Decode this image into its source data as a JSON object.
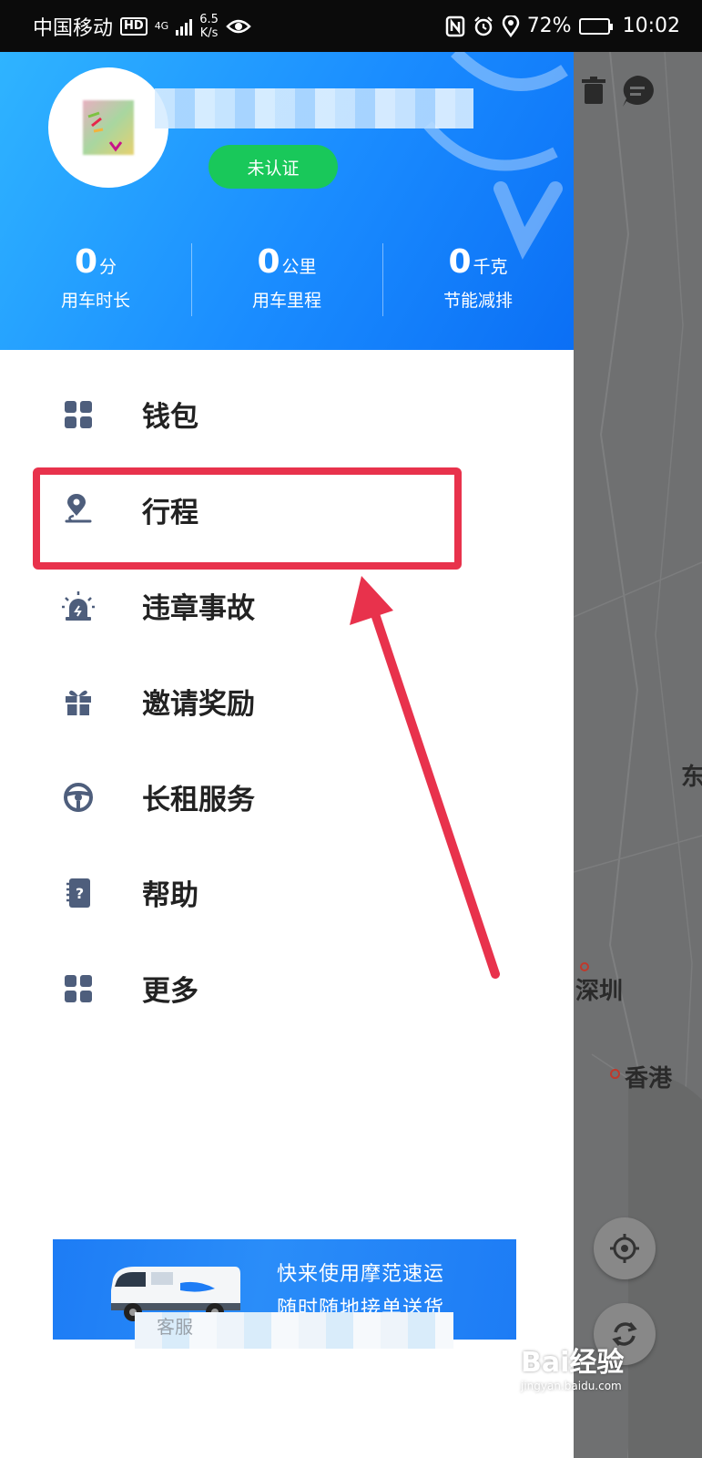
{
  "status_bar": {
    "carrier": "中国移动",
    "hd": "HD",
    "network": "4G",
    "speed_value": "6.5",
    "speed_unit": "K/s",
    "battery": "72%",
    "battery_level": 0.72,
    "time": "10:02"
  },
  "profile": {
    "cert_label": "未认证"
  },
  "stats": [
    {
      "value": "0",
      "unit": "分",
      "label": "用车时长"
    },
    {
      "value": "0",
      "unit": "公里",
      "label": "用车里程"
    },
    {
      "value": "0",
      "unit": "千克",
      "label": "节能减排"
    }
  ],
  "menu": [
    {
      "label": "钱包",
      "icon": "wallet-grid-icon"
    },
    {
      "label": "行程",
      "icon": "location-pin-icon"
    },
    {
      "label": "违章事故",
      "icon": "alarm-light-icon"
    },
    {
      "label": "邀请奖励",
      "icon": "gift-icon"
    },
    {
      "label": "长租服务",
      "icon": "steering-wheel-icon"
    },
    {
      "label": "帮助",
      "icon": "help-book-icon"
    },
    {
      "label": "更多",
      "icon": "more-grid-icon"
    }
  ],
  "banner": {
    "line1": "快来使用摩范速运",
    "line2": "随时随地接单送货"
  },
  "bottom": {
    "partial_text": "客服"
  },
  "map": {
    "city1": "深圳",
    "city2": "香港",
    "edge_char": "东"
  },
  "watermark": {
    "brand": "Bai经验",
    "url": "jingyan.baidu.com"
  },
  "colors": {
    "accent_blue": "#1a8cff",
    "cert_green": "#19c85a",
    "highlight_red": "#e8324c"
  }
}
